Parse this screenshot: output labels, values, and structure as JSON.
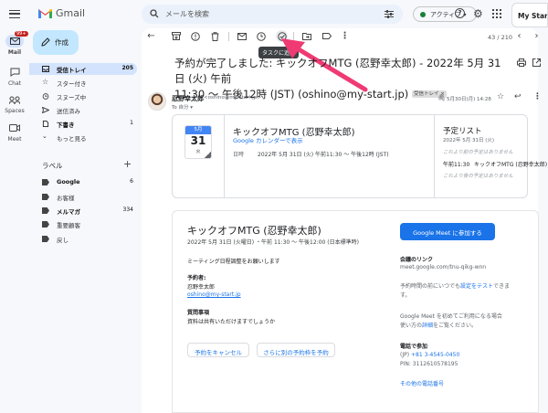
{
  "app": {
    "name": "Gmail",
    "unread_badge": "99+"
  },
  "rail": [
    {
      "label": "Mail",
      "icon": "mail-icon"
    },
    {
      "label": "Chat",
      "icon": "chat-icon"
    },
    {
      "label": "Spaces",
      "icon": "spaces-icon"
    },
    {
      "label": "Meet",
      "icon": "meet-icon"
    }
  ],
  "search": {
    "placeholder": "メールを検索"
  },
  "status": {
    "label": "アクティブ",
    "color": "#188038"
  },
  "account": {
    "label": "My Start"
  },
  "compose": {
    "label": "作成"
  },
  "nav": [
    {
      "label": "受信トレイ",
      "count": "205",
      "icon": "inbox-icon"
    },
    {
      "label": "スター付き",
      "count": "",
      "icon": "star-icon"
    },
    {
      "label": "スヌーズ中",
      "count": "",
      "icon": "clock-icon"
    },
    {
      "label": "送信済み",
      "count": "",
      "icon": "send-icon"
    },
    {
      "label": "下書き",
      "count": "1",
      "icon": "draft-icon"
    },
    {
      "label": "もっと見る",
      "count": "",
      "icon": "chevron-down-icon"
    }
  ],
  "labels": {
    "heading": "ラベル",
    "items": [
      {
        "label": "Google",
        "count": "6",
        "bold": true
      },
      {
        "label": "お客様",
        "count": "",
        "bold": false
      },
      {
        "label": "メルマガ",
        "count": "334",
        "bold": true
      },
      {
        "label": "重要顧客",
        "count": "",
        "bold": false
      },
      {
        "label": "戻し",
        "count": "",
        "bold": false
      }
    ]
  },
  "toolbar": {
    "tooltip": "タスクに追加",
    "pager": "43 / 210"
  },
  "email": {
    "subject": "予約が完了しました: キックオフMTG (忍野幸太郎) - 2022年 5月 31日 (火) 午前 11:30 ～ 午後12時 (JST) (oshino@my-start.jp)",
    "subject_line1": "予約が完了しました: キックオフMTG (忍野幸太郎) - 2022年 5月 31日 (火) 午前",
    "subject_line2": "11:30 ～ 午後12時 (JST) (oshino@my-start.jp)",
    "label_chip": "受信トレイ",
    "sender_name": "忍野幸太郎",
    "sender_email": "<oshino@my-start.jp>",
    "to": "To 自分",
    "date": "5月30日(月) 14:28"
  },
  "calendar_card": {
    "month": "5月",
    "day": "31",
    "weekday": "火",
    "title": "キックオフMTG (忍野幸太郎)",
    "gcal_link": "Google カレンダーで表示",
    "when_label": "日時",
    "when_value": "2022年 5月 31日 (火) 午前11:30 ～ 午後12時 (JST)",
    "agenda_title": "予定リスト",
    "agenda_date": "2022年 5月 31日 (火)",
    "agenda_before": "これより前の予定はありません",
    "agenda_time": "午前11:30",
    "agenda_event": "キックオフMTG (忍野幸太郎)",
    "agenda_after": "これより後の予定はありません"
  },
  "invite": {
    "title": "キックオフMTG (忍野幸太郎)",
    "datetime": "2022年 5月 31日 (火曜日) ・午前 11:30 ～ 午後12:00 (日本標準時)",
    "message": "ミーティング日程調整をお願いします",
    "booker_label": "予約者:",
    "booker_name": "忍野幸太郎",
    "booker_email": "oshino@my-start.jp",
    "question_label": "質問事項",
    "question_text": "資料は共有いただけますでしょうか",
    "cancel_button": "予約をキャンセル",
    "another_button": "さらに別の予約枠を予約",
    "meet_button": "Google Meet に参加する",
    "meet_link_label": "会議のリンク",
    "meet_link": "meet.google.com/tnu-qikg-wnn",
    "test_text": "予約時間の前にいつでも",
    "test_link": "設定をテスト",
    "test_suffix": "できま",
    "test_suffix2": "す。",
    "first_time1": "Google Meet を初めてご利用になる場合",
    "first_time2_a": "使い方の",
    "first_time2_b": "詳細",
    "first_time2_c": "をご覧ください。",
    "phone_label": "電話で参加",
    "phone_number_prefix": "(JP)",
    "phone_number": "+81 3-4545-0450",
    "pin": "PIN: 3112610578195",
    "more_numbers": "その他の電話番号"
  },
  "colors": {
    "accent": "#1a73e8",
    "arrow": "#ef3a73",
    "compose": "#c2e7ff",
    "active_nav": "#d3e3fd"
  }
}
